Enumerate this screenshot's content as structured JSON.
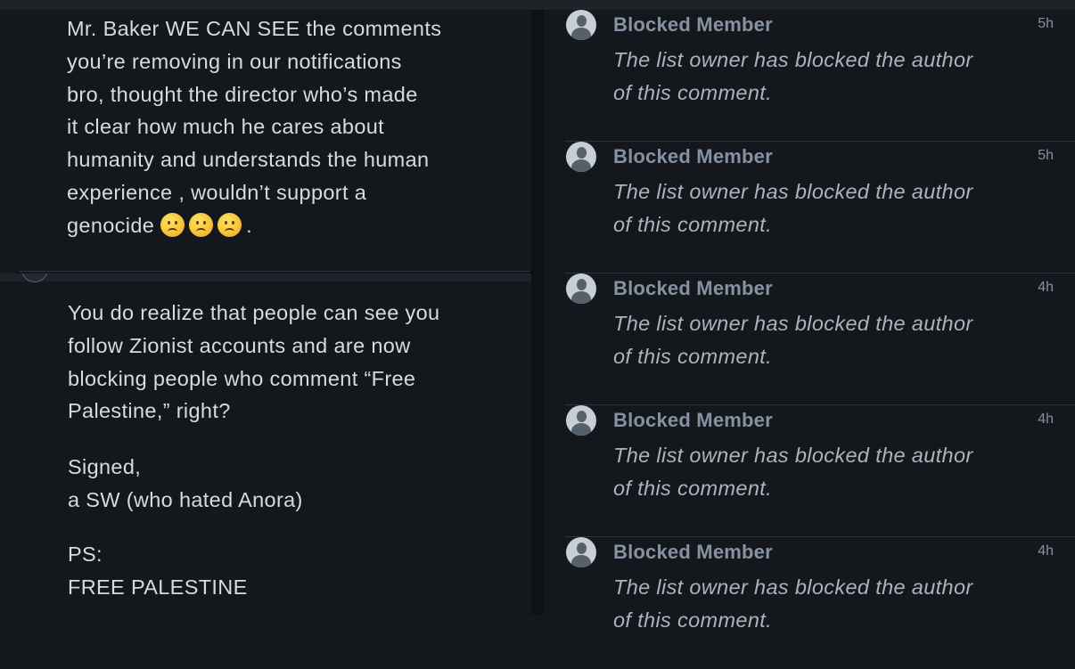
{
  "left": {
    "comment_1": {
      "lines": [
        "Mr. Baker WE CAN SEE the comments",
        "you’re removing in our notifications",
        "bro, thought the director who’s made",
        "it clear how much he cares about",
        "humanity and understands the human",
        "experience , wouldn’t support a",
        "genocide"
      ],
      "end_punct": ".",
      "emoji_name": "slightly-frowning-face-icon"
    },
    "comment_2": {
      "paragraph_1": [
        "You do realize that people can see you",
        "follow Zionist accounts and are now",
        "blocking people who comment “Free",
        "Palestine,” right?"
      ],
      "paragraph_2": [
        "Signed,",
        "a SW (who hated Anora)"
      ],
      "paragraph_3": [
        "PS:",
        "FREE PALESTINE"
      ]
    }
  },
  "right": {
    "items": [
      {
        "name": "Blocked Member",
        "time": "5h",
        "text_1": "The list owner has blocked the author",
        "text_2": "of this comment."
      },
      {
        "name": "Blocked Member",
        "time": "5h",
        "text_1": "The list owner has blocked the author",
        "text_2": "of this comment."
      },
      {
        "name": "Blocked Member",
        "time": "4h",
        "text_1": "The list owner has blocked the author",
        "text_2": "of this comment."
      },
      {
        "name": "Blocked Member",
        "time": "4h",
        "text_1": "The list owner has blocked the author",
        "text_2": "of this comment."
      },
      {
        "name": "Blocked Member",
        "time": "4h",
        "text_1": "The list owner has blocked the author",
        "text_2": "of this comment."
      }
    ]
  },
  "colors": {
    "background": "#14181c",
    "text": "#d5dbe1",
    "muted": "#8592a2",
    "divider": "#2c3440"
  }
}
